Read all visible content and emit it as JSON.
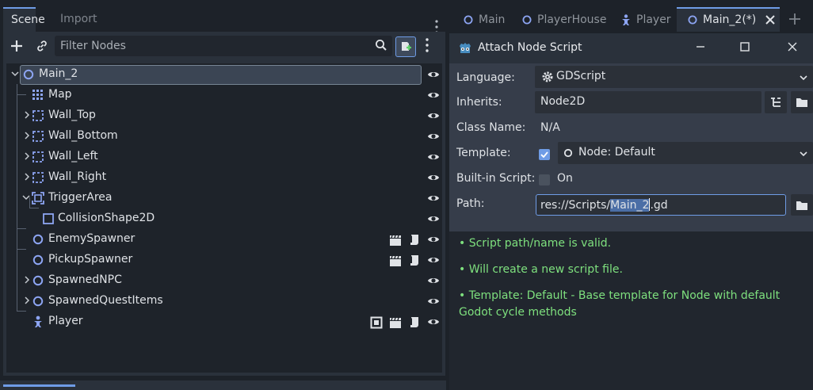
{
  "dock": {
    "tabs": [
      "Scene",
      "Import"
    ],
    "filter_placeholder": "Filter Nodes",
    "tree": [
      {
        "label": "Main_2",
        "icon": "node2d-icon",
        "selected": true
      },
      {
        "label": "Map",
        "icon": "tilemap-icon"
      },
      {
        "label": "Wall_Top",
        "icon": "staticbody-icon",
        "collapsed": true
      },
      {
        "label": "Wall_Bottom",
        "icon": "staticbody-icon",
        "collapsed": true
      },
      {
        "label": "Wall_Left",
        "icon": "staticbody-icon",
        "collapsed": true
      },
      {
        "label": "Wall_Right",
        "icon": "staticbody-icon",
        "collapsed": true
      },
      {
        "label": "TriggerArea",
        "icon": "area2d-icon",
        "expanded": true
      },
      {
        "label": "CollisionShape2D",
        "icon": "collisionshape-icon"
      },
      {
        "label": "EnemySpawner",
        "icon": "node2d-icon",
        "badges": [
          "clapper-icon",
          "script-icon"
        ]
      },
      {
        "label": "PickupSpawner",
        "icon": "node2d-icon",
        "badges": [
          "clapper-icon",
          "script-icon"
        ]
      },
      {
        "label": "SpawnedNPC",
        "icon": "node2d-icon",
        "collapsed": true
      },
      {
        "label": "SpawnedQuestItems",
        "icon": "node2d-icon",
        "collapsed": true
      },
      {
        "label": "Player",
        "icon": "player-icon",
        "badges": [
          "instance-icon",
          "clapper-icon",
          "script-icon"
        ]
      }
    ]
  },
  "editor_tabs": [
    {
      "label": "Main",
      "icon": "node2d-icon"
    },
    {
      "label": "PlayerHouse",
      "icon": "node2d-icon"
    },
    {
      "label": "Player",
      "icon": "player-icon"
    },
    {
      "label": "Main_2(*)",
      "icon": "node2d-icon",
      "active": true
    }
  ],
  "dialog": {
    "title": "Attach Node Script",
    "labels": {
      "language": "Language:",
      "inherits": "Inherits:",
      "class_name": "Class Name:",
      "template": "Template:",
      "builtin": "Built-in Script:",
      "path": "Path:"
    },
    "language_value": "GDScript",
    "inherits_value": "Node2D",
    "class_name_value": "N/A",
    "template_value": "Node: Default",
    "template_checked": true,
    "builtin_on_label": "On",
    "builtin_checked": false,
    "path_prefix": "res://Scripts/",
    "path_selected": "Main_2",
    "path_suffix": ".gd",
    "messages": [
      "•  Script path/name is valid.",
      "•  Will create a new script file.",
      "•  Template: Default - Base template for Node with default Godot cycle methods"
    ]
  },
  "colors": {
    "accent": "#6f9ce6",
    "success_text": "#7ee07e",
    "node_icon": "#8da5f3"
  }
}
